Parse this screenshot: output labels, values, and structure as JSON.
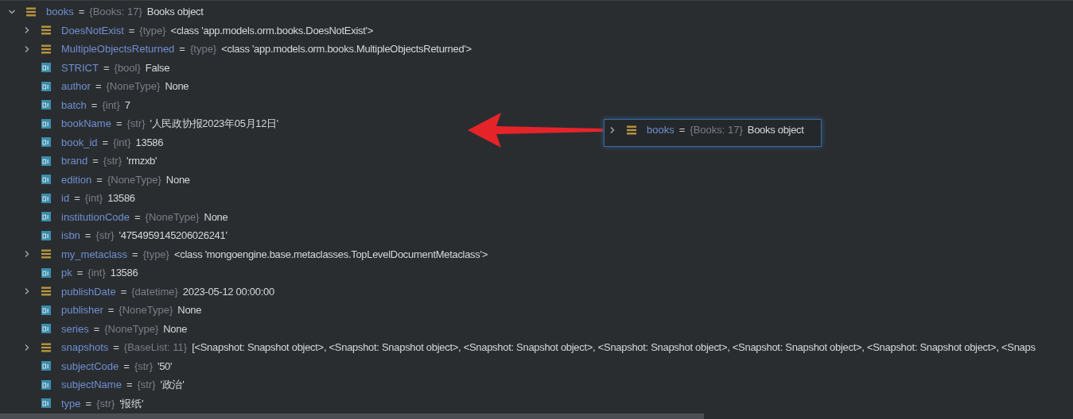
{
  "variables": [
    {
      "kind": "object",
      "name": "books",
      "sep": "=",
      "type": "{Books: 17}",
      "value": "Books object",
      "expanded": true,
      "children": [
        {
          "kind": "object",
          "name": "DoesNotExist",
          "sep": "=",
          "type": "{type}",
          "value": "<class 'app.models.orm.books.DoesNotExist'>",
          "expanded": false
        },
        {
          "kind": "object",
          "name": "MultipleObjectsReturned",
          "sep": "=",
          "type": "{type}",
          "value": "<class 'app.models.orm.books.MultipleObjectsReturned'>",
          "expanded": false
        },
        {
          "kind": "field",
          "name": "STRICT",
          "sep": "=",
          "type": "{bool}",
          "value": "False"
        },
        {
          "kind": "field",
          "name": "author",
          "sep": "=",
          "type": "{NoneType}",
          "value": "None"
        },
        {
          "kind": "field",
          "name": "batch",
          "sep": "=",
          "type": "{int}",
          "value": "7"
        },
        {
          "kind": "field",
          "name": "bookName",
          "sep": "=",
          "type": "{str}",
          "value": "'人民政协报2023年05月12日'"
        },
        {
          "kind": "field",
          "name": "book_id",
          "sep": "=",
          "type": "{int}",
          "value": "13586"
        },
        {
          "kind": "field",
          "name": "brand",
          "sep": "=",
          "type": "{str}",
          "value": "'rmzxb'"
        },
        {
          "kind": "field",
          "name": "edition",
          "sep": "=",
          "type": "{NoneType}",
          "value": "None"
        },
        {
          "kind": "field",
          "name": "id",
          "sep": "=",
          "type": "{int}",
          "value": "13586"
        },
        {
          "kind": "field",
          "name": "institutionCode",
          "sep": "=",
          "type": "{NoneType}",
          "value": "None"
        },
        {
          "kind": "field",
          "name": "isbn",
          "sep": "=",
          "type": "{str}",
          "value": "'4754959145206026241'"
        },
        {
          "kind": "object",
          "name": "my_metaclass",
          "sep": "=",
          "type": "{type}",
          "value": "<class 'mongoengine.base.metaclasses.TopLevelDocumentMetaclass'>",
          "expanded": false
        },
        {
          "kind": "field",
          "name": "pk",
          "sep": "=",
          "type": "{int}",
          "value": "13586"
        },
        {
          "kind": "object",
          "name": "publishDate",
          "sep": "=",
          "type": "{datetime}",
          "value": "2023-05-12 00:00:00",
          "expanded": false
        },
        {
          "kind": "field",
          "name": "publisher",
          "sep": "=",
          "type": "{NoneType}",
          "value": "None"
        },
        {
          "kind": "field",
          "name": "series",
          "sep": "=",
          "type": "{NoneType}",
          "value": "None"
        },
        {
          "kind": "object",
          "name": "snapshots",
          "sep": "=",
          "type": "{BaseList: 11}",
          "value": "[<Snapshot: Snapshot object>, <Snapshot: Snapshot object>, <Snapshot: Snapshot object>, <Snapshot: Snapshot object>, <Snapshot: Snapshot object>, <Snapshot: Snapshot object>, <Snaps",
          "expanded": false
        },
        {
          "kind": "field",
          "name": "subjectCode",
          "sep": "=",
          "type": "{str}",
          "value": "'50'"
        },
        {
          "kind": "field",
          "name": "subjectName",
          "sep": "=",
          "type": "{str}",
          "value": "'政治'"
        },
        {
          "kind": "field",
          "name": "type",
          "sep": "=",
          "type": "{str}",
          "value": "'报纸'"
        }
      ]
    }
  ],
  "popup": {
    "kind": "object",
    "name": "books",
    "sep": "=",
    "type": "{Books: 17}",
    "value": "Books object",
    "expanded": false
  }
}
